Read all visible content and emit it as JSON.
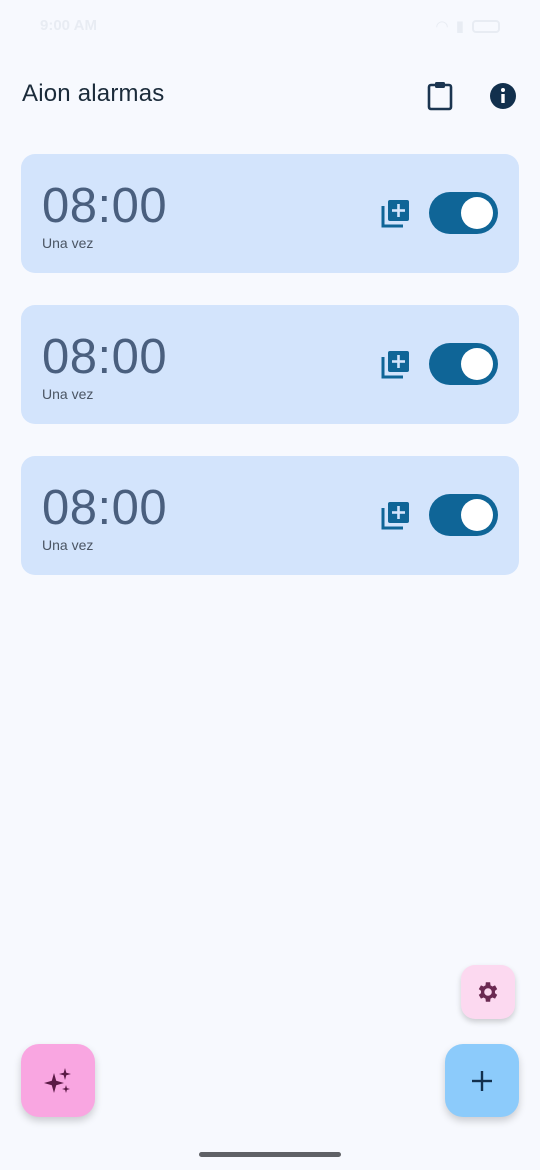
{
  "status_bar": {
    "time": "9:00 AM",
    "battery": ""
  },
  "app_bar": {
    "title": "Aion alarmas",
    "icons": {
      "clipboard": "clipboard-icon",
      "info": "info-icon"
    }
  },
  "alarms": [
    {
      "time": "08:00",
      "repeat": "Una vez",
      "enabled": true
    },
    {
      "time": "08:00",
      "repeat": "Una vez",
      "enabled": true
    },
    {
      "time": "08:00",
      "repeat": "Una vez",
      "enabled": true
    }
  ],
  "fabs": {
    "settings": {
      "icon": "gear-icon",
      "color": "#fcd9f0"
    },
    "magic": {
      "icon": "sparkles-icon",
      "color": "#f9a6e1"
    },
    "add": {
      "icon": "plus-icon",
      "color": "#8ccbfb"
    }
  },
  "colors": {
    "background": "#f7f9fe",
    "card": "#d3e4fc",
    "toggle_on": "#0f6597",
    "accent_icon": "#0f6597"
  }
}
